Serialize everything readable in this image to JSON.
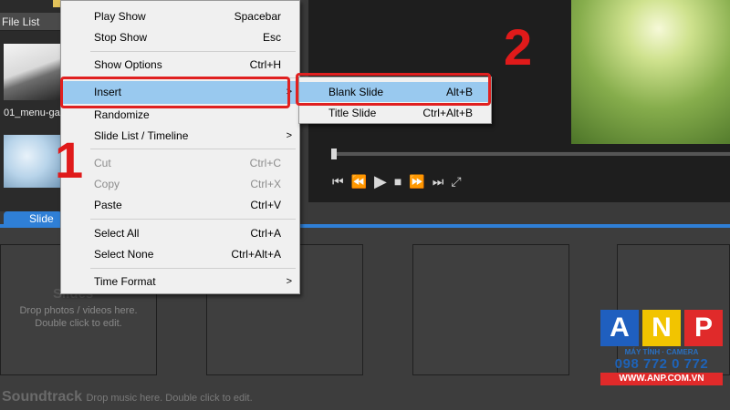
{
  "file_list": {
    "header": "File List",
    "items": [
      {
        "caption": "01_menu-ga"
      }
    ]
  },
  "context_menu": {
    "items": [
      {
        "label": "Play Show",
        "shortcut": "Spacebar"
      },
      {
        "label": "Stop Show",
        "shortcut": "Esc"
      },
      {
        "label": "Show Options",
        "shortcut": "Ctrl+H"
      },
      {
        "label": "Insert",
        "shortcut": "",
        "submenu": true,
        "highlighted": true
      },
      {
        "label": "Randomize",
        "shortcut": ""
      },
      {
        "label": "Slide List / Timeline",
        "shortcut": "",
        "submenu": true
      },
      {
        "label": "Cut",
        "shortcut": "Ctrl+C",
        "disabled": true
      },
      {
        "label": "Copy",
        "shortcut": "Ctrl+X",
        "disabled": true
      },
      {
        "label": "Paste",
        "shortcut": "Ctrl+V"
      },
      {
        "label": "Select All",
        "shortcut": "Ctrl+A"
      },
      {
        "label": "Select None",
        "shortcut": "Ctrl+Alt+A"
      },
      {
        "label": "Time Format",
        "shortcut": "",
        "submenu": true
      }
    ],
    "submenu_arrow": ">"
  },
  "insert_submenu": {
    "items": [
      {
        "label": "Blank Slide",
        "shortcut": "Alt+B",
        "highlighted": true
      },
      {
        "label": "Title Slide",
        "shortcut": "Ctrl+Alt+B"
      }
    ]
  },
  "annotations": {
    "step1": "1",
    "step2": "2",
    "color": "#e02020"
  },
  "tabs": {
    "slide": "Slide"
  },
  "storyboard": {
    "slot_title": "Slides",
    "slot_hint_line1": "Drop photos / videos here.",
    "slot_hint_line2": "Double click to edit.",
    "soundtrack_label": "Soundtrack",
    "soundtrack_hint": "Drop music here.  Double click to edit."
  },
  "transport": {
    "icons": [
      "skip-back-icon",
      "rewind-icon",
      "play-icon",
      "stop-icon",
      "forward-icon",
      "skip-forward-icon",
      "fullscreen-icon"
    ]
  },
  "logo": {
    "letters": [
      "A",
      "N",
      "P"
    ],
    "tagline": "MÁY TÍNH · CAMERA",
    "phone": "098 772 0 772",
    "website": "WWW.ANP.COM.VN",
    "colors": {
      "a": "#1f5fbf",
      "n": "#f2c400",
      "p": "#e02a2a"
    }
  },
  "colors": {
    "accent": "#2f7fd6",
    "highlight": "#99c9ef"
  }
}
